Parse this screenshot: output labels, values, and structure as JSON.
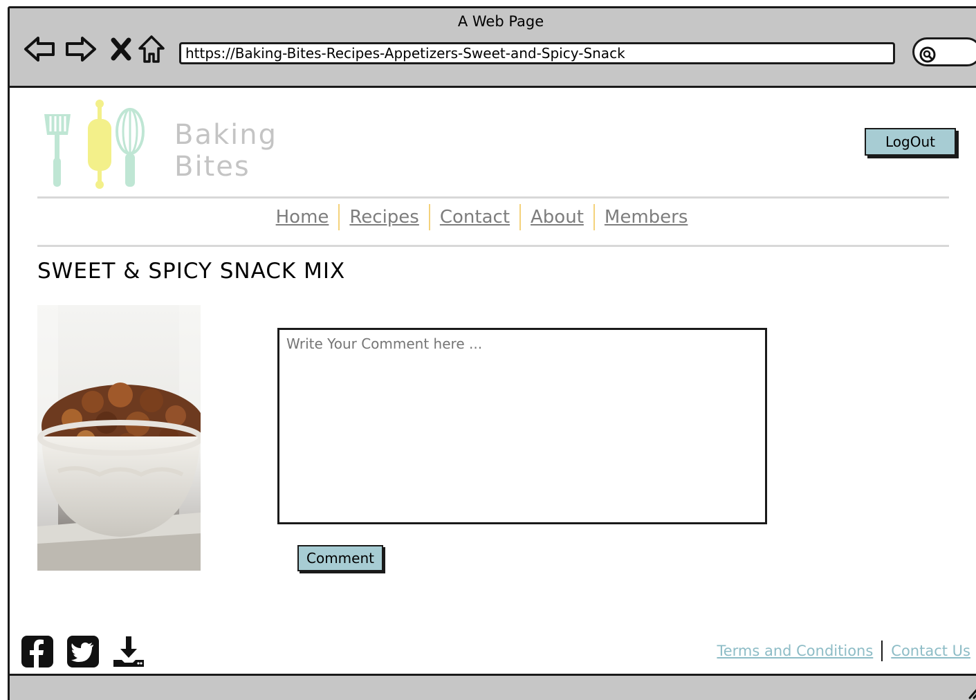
{
  "window": {
    "title": "A Web Page",
    "url": "https://Baking-Bites-Recipes-Appetizers-Sweet-and-Spicy-Snack"
  },
  "icons": {
    "back": "arrow-left-icon",
    "forward": "arrow-right-icon",
    "stop": "close-icon",
    "home": "home-icon",
    "search": "search-icon",
    "facebook": "facebook-icon",
    "twitter": "twitter-icon",
    "download": "download-icon"
  },
  "header": {
    "logo_line1": "Baking",
    "logo_line2": "Bites",
    "logout_label": "LogOut"
  },
  "nav": {
    "items": [
      {
        "label": "Home"
      },
      {
        "label": "Recipes"
      },
      {
        "label": "Contact"
      },
      {
        "label": "About"
      },
      {
        "label": "Members"
      }
    ]
  },
  "main": {
    "title": "SWEET & SPICY SNACK MIX",
    "comment_placeholder": "Write Your Comment here ...",
    "comment_value": "",
    "comment_button_label": "Comment"
  },
  "footer": {
    "terms_label": "Terms and Conditions",
    "contact_label": "Contact Us"
  },
  "colors": {
    "chrome": "#c6c6c6",
    "button_fill": "#a7ccd3",
    "nav_link": "#7d7d7d",
    "nav_separator": "#f4d27b",
    "footer_link": "#8dbcc6"
  }
}
